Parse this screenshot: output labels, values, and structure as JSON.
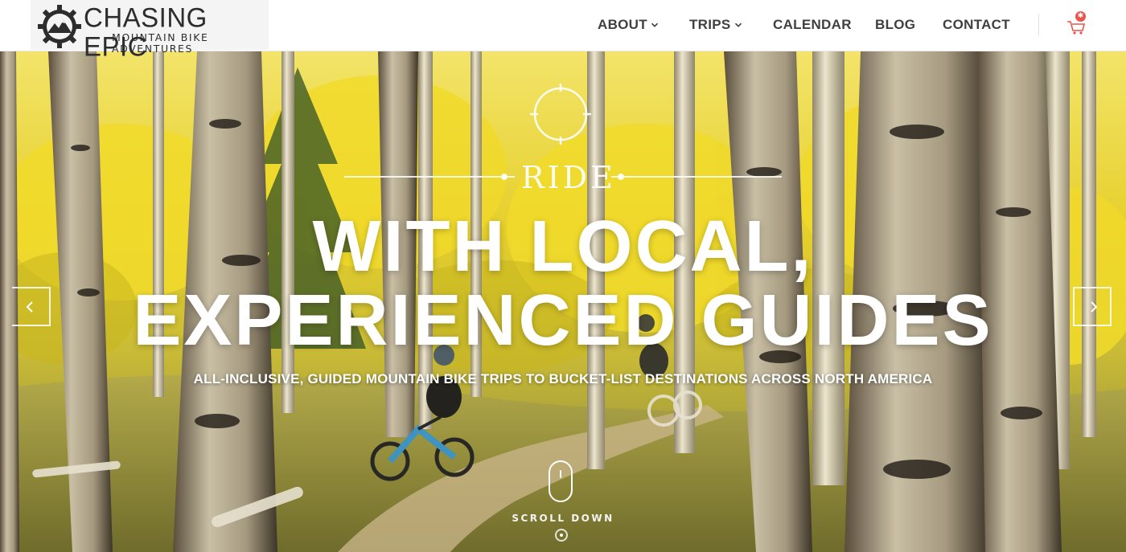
{
  "brand": {
    "title": "CHASING EPIC",
    "subtitle": "MOUNTAIN BIKE ADVENTURES"
  },
  "nav": {
    "items": [
      {
        "label": "ABOUT",
        "dropdown": true
      },
      {
        "label": "TRIPS",
        "dropdown": true
      },
      {
        "label": "CALENDAR",
        "dropdown": false
      },
      {
        "label": "BLOG",
        "dropdown": false
      },
      {
        "label": "CONTACT",
        "dropdown": false
      }
    ],
    "cart_icon": "shopping-cart-icon"
  },
  "hero": {
    "eyebrow": "RIDE",
    "headline_line1": "WITH LOCAL,",
    "headline_line2": "EXPERIENCED GUIDES",
    "tagline": "ALL-INCLUSIVE, GUIDED MOUNTAIN BIKE TRIPS TO BUCKET-LIST DESTINATIONS ACROSS NORTH AMERICA",
    "scroll_label": "SCROLL DOWN"
  },
  "colors": {
    "nav_text": "#3f3f3f",
    "cart_badge": "#e9554a",
    "hero_text": "#ffffff",
    "aspen_yellow": "#e8d43a"
  }
}
